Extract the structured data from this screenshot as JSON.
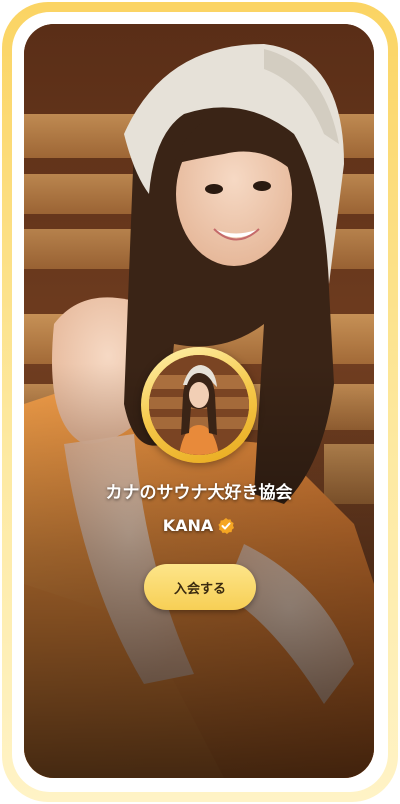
{
  "community": {
    "name": "カナのサウナ大好き協会"
  },
  "owner": {
    "name": "KANA",
    "badge_icon": "verified-check-icon"
  },
  "actions": {
    "join_label": "入会する"
  },
  "theme": {
    "frame_color": "#fbd463",
    "button_color": "#f7cf55",
    "badge_color": "#f5a623"
  }
}
